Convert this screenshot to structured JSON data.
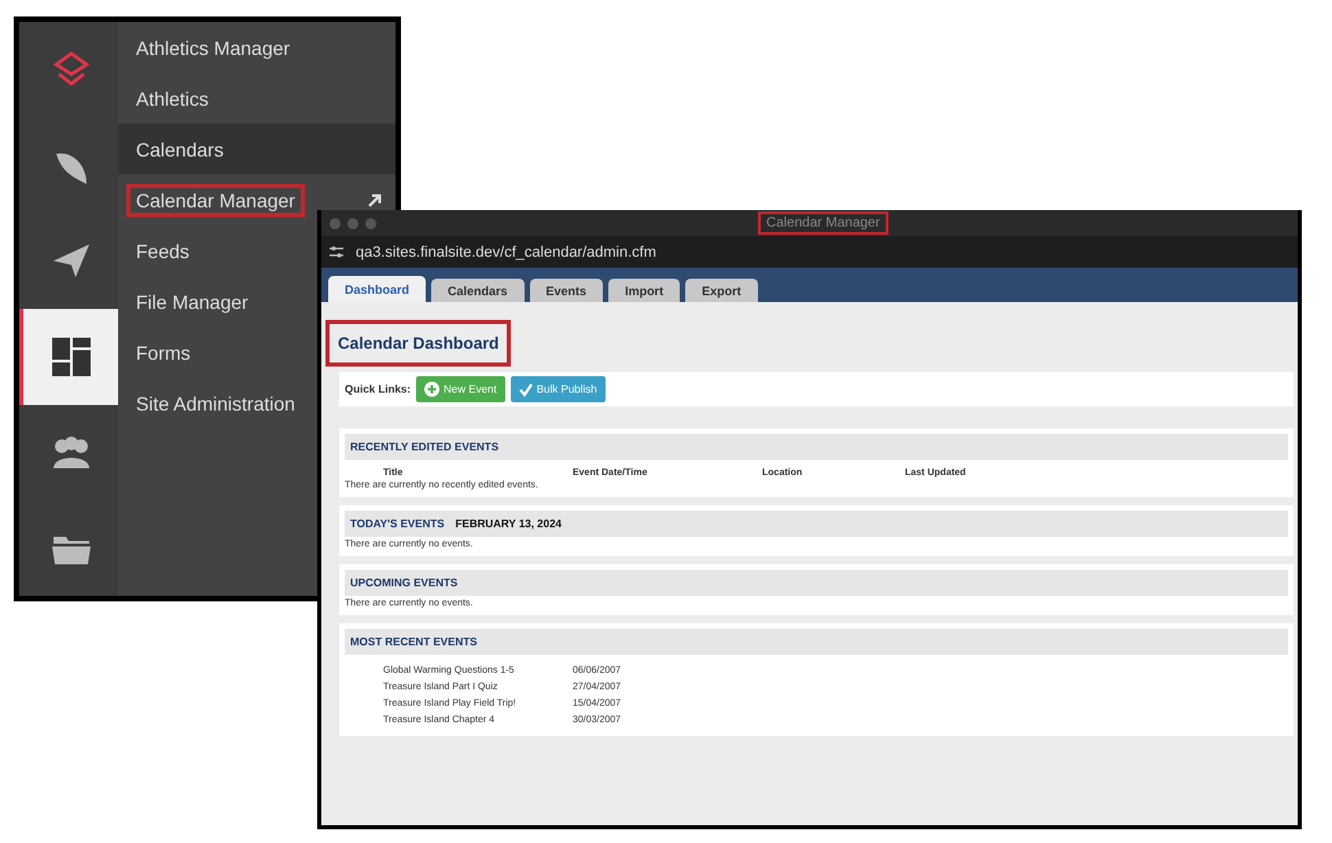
{
  "nav_panel": {
    "rail": [
      {
        "kind": "logo",
        "selected": false
      },
      {
        "kind": "feather",
        "selected": false
      },
      {
        "kind": "plane",
        "selected": false
      },
      {
        "kind": "dashboard",
        "selected": true
      },
      {
        "kind": "people",
        "selected": false
      },
      {
        "kind": "folder",
        "selected": false
      }
    ],
    "menu": [
      {
        "label": "Athletics Manager",
        "selected": false,
        "highlighted": false,
        "external": false
      },
      {
        "label": "Athletics",
        "selected": false,
        "highlighted": false,
        "external": false
      },
      {
        "label": "Calendars",
        "selected": true,
        "highlighted": false,
        "external": false
      },
      {
        "label": "Calendar Manager",
        "selected": false,
        "highlighted": true,
        "external": true
      },
      {
        "label": "Feeds",
        "selected": false,
        "highlighted": false,
        "external": false
      },
      {
        "label": "File Manager",
        "selected": false,
        "highlighted": false,
        "external": false
      },
      {
        "label": "Forms",
        "selected": false,
        "highlighted": false,
        "external": false
      },
      {
        "label": "Site Administration",
        "selected": false,
        "highlighted": false,
        "external": false
      }
    ]
  },
  "window": {
    "title": "Calendar Manager",
    "title_highlighted": true,
    "url": "qa3.sites.finalsite.dev/cf_calendar/admin.cfm",
    "tabs": [
      {
        "label": "Dashboard",
        "selected": true
      },
      {
        "label": "Calendars",
        "selected": false
      },
      {
        "label": "Events",
        "selected": false
      },
      {
        "label": "Import",
        "selected": false
      },
      {
        "label": "Export",
        "selected": false
      }
    ],
    "heading": "Calendar Dashboard",
    "heading_highlighted": true,
    "quick_links": {
      "label": "Quick Links:",
      "buttons": [
        {
          "label": "New Event",
          "kind": "add"
        },
        {
          "label": "Bulk Publish",
          "kind": "publish"
        }
      ]
    },
    "sections": [
      {
        "title": "RECENTLY EDITED EVENTS",
        "columns": [
          "Title",
          "Event Date/Time",
          "Location",
          "Last Updated"
        ],
        "empty": "There are currently no recently edited events."
      },
      {
        "title": "TODAY'S EVENTS",
        "date": "FEBRUARY 13, 2024",
        "empty": "There are currently no events."
      },
      {
        "title": "UPCOMING EVENTS",
        "empty": "There are currently no events."
      },
      {
        "title": "MOST RECENT EVENTS",
        "rows": [
          [
            "Global Warming Questions 1-5",
            "06/06/2007"
          ],
          [
            "Treasure Island Part I Quiz",
            "27/04/2007"
          ],
          [
            "Treasure Island Play Field Trip!",
            "15/04/2007"
          ],
          [
            "Treasure Island Chapter 4",
            "30/03/2007"
          ]
        ]
      }
    ]
  }
}
